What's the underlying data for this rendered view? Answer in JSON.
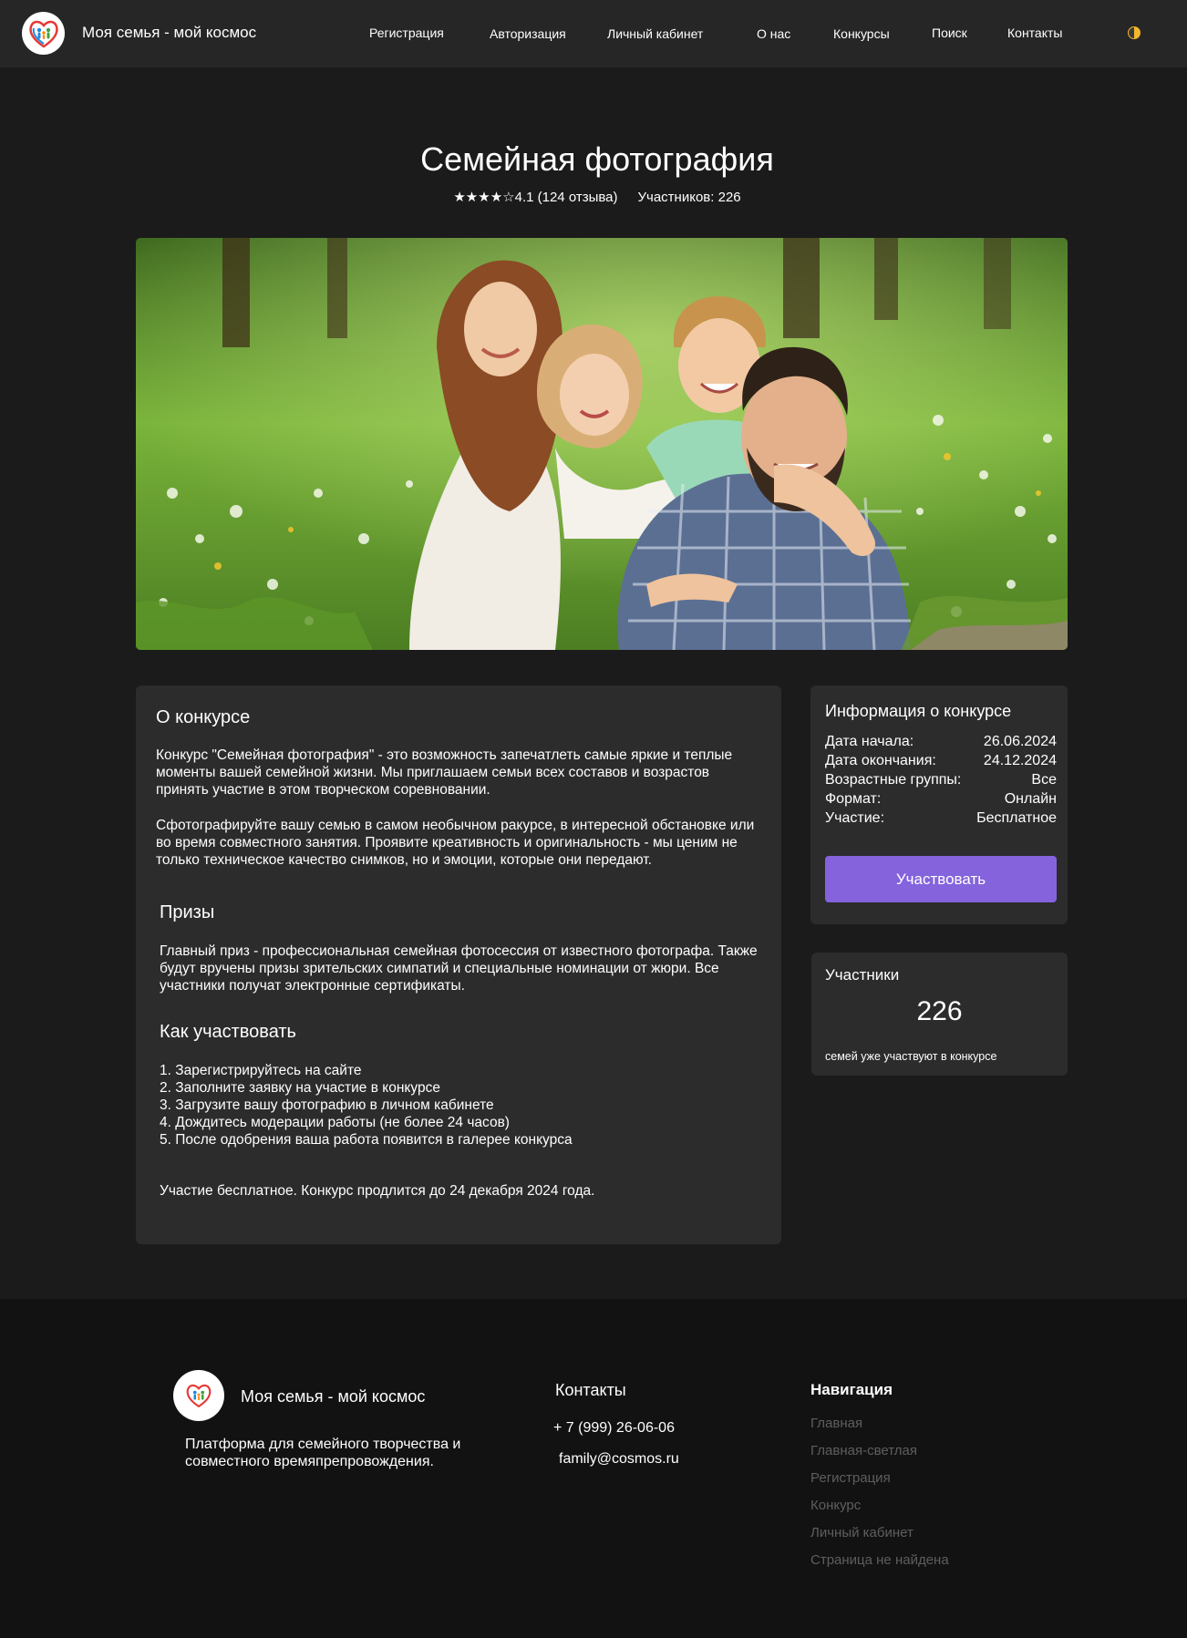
{
  "header": {
    "brand": "Моя семья - мой космос",
    "nav": [
      {
        "label": "Регистрация"
      },
      {
        "label": "Авторизация"
      },
      {
        "label": "Личный кабинет"
      },
      {
        "label": "О нас"
      },
      {
        "label": "Конкурсы"
      },
      {
        "label": "Поиск"
      },
      {
        "label": "Контакты"
      }
    ]
  },
  "contest": {
    "title": "Семейная фотография",
    "stars": "★★★★☆",
    "rating": "4.1 (124 отзыва)",
    "participants_label": "Участников: 226"
  },
  "about": {
    "heading": "О конкурсе",
    "p1": "Конкурс \"Семейная фотография\" - это возможность запечатлеть самые яркие и теплые моменты вашей семейной жизни. Мы приглашаем семьи всех составов и возрастов принять участие в этом творческом соревновании.",
    "p2": "Сфотографируйте вашу семью в самом необычном ракурсе, в интересной обстановке или во время совместного занятия. Проявите креативность и оригинальность - мы ценим не только техническое качество снимков, но и эмоции, которые они передают.",
    "prizes_heading": "Призы",
    "prizes_text": "Главный приз - профессиональная семейная фотосессия от известного фотографа. Также будут вручены призы зрительских симпатий и специальные номинации от жюри. Все участники получат электронные сертификаты.",
    "how_heading": "Как участвовать",
    "steps": [
      "1. Зарегистрируйтесь на сайте",
      "2. Заполните заявку на участие в конкурсе",
      "3. Загрузите вашу фотографию в личном кабинете",
      "4. Дождитесь модерации работы (не более 24 часов)",
      "5. После одобрения ваша работа появится в галерее конкурса"
    ],
    "closing": "Участие бесплатное. Конкурс продлится до 24 декабря 2024 года."
  },
  "info": {
    "heading": "Информация о конкурсе",
    "rows": [
      {
        "label": "Дата начала:",
        "value": "26.06.2024"
      },
      {
        "label": "Дата окончания:",
        "value": "24.12.2024"
      },
      {
        "label": "Возрастные группы:",
        "value": "Все"
      },
      {
        "label": "Формат:",
        "value": "Онлайн"
      },
      {
        "label": "Участие:",
        "value": "Бесплатное"
      }
    ],
    "button": "Участвовать"
  },
  "participants": {
    "heading": "Участники",
    "count": "226",
    "sub": "семей уже участвуют в конкурсе"
  },
  "footer": {
    "brand": "Моя семья - мой космос",
    "desc": "Платформа для семейного творчества и совместного времяпрепровождения.",
    "contacts_title": "Контакты",
    "phone": "+ 7 (999) 26-06-06",
    "email": "family@cosmos.ru",
    "nav_title": "Навигация",
    "nav": [
      {
        "label": "Главная"
      },
      {
        "label": "Главная-светлая"
      },
      {
        "label": "Регистрация"
      },
      {
        "label": "Конкурс"
      },
      {
        "label": "Личный кабинет"
      },
      {
        "label": "Страница не найдена"
      }
    ]
  },
  "colors": {
    "accent": "#8463dc",
    "background": "#1b1b1b",
    "card": "#2c2c2c",
    "header": "#262626",
    "footer": "#121212",
    "footer_link": "#5e5e5e"
  }
}
